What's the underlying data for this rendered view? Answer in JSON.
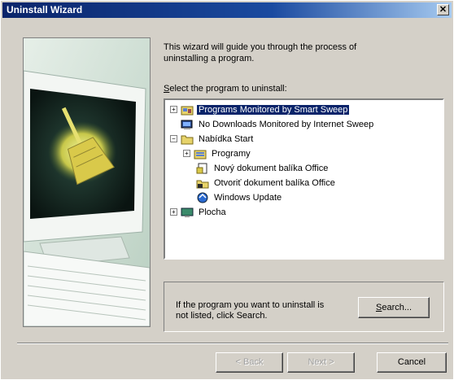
{
  "window": {
    "title": "Uninstall Wizard"
  },
  "intro": {
    "line1": "This wizard will guide you through the process of",
    "line2": "uninstalling a program."
  },
  "select_label": {
    "prefix": "S",
    "rest": "elect the program to uninstall:"
  },
  "tree": {
    "items": [
      {
        "label": "Programs Monitored by Smart Sweep",
        "selected": true,
        "icon": "programs-folder-icon"
      },
      {
        "label": "No Downloads Monitored by Internet Sweep",
        "icon": "internet-sweep-icon"
      },
      {
        "label": "Nabídka Start",
        "icon": "start-menu-folder-icon"
      },
      {
        "label": "Programy",
        "icon": "programs-folder-icon"
      },
      {
        "label": "Nový dokument balíka Office",
        "icon": "office-new-doc-icon"
      },
      {
        "label": "Otvoriť dokument balíka Office",
        "icon": "office-open-doc-icon"
      },
      {
        "label": "Windows Update",
        "icon": "windows-update-icon"
      },
      {
        "label": "Plocha",
        "icon": "desktop-icon"
      }
    ]
  },
  "search_group": {
    "line1": "If the program you want to uninstall is",
    "line2": "not listed, click Search.",
    "button_prefix": "S",
    "button_rest": "earch..."
  },
  "buttons": {
    "back": "< Back",
    "next": "Next >",
    "cancel": "Cancel"
  }
}
